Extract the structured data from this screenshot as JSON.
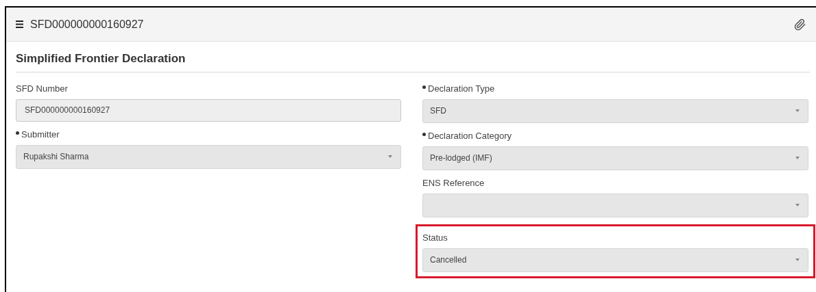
{
  "header": {
    "title": "SFD000000000160927"
  },
  "section": {
    "title": "Simplified Frontier Declaration"
  },
  "columns": [
    {
      "fields": [
        {
          "label": "SFD Number",
          "required": false,
          "kind": "text",
          "value": "SFD000000000160927",
          "highlighted": false
        },
        {
          "label": "Submitter",
          "required": true,
          "kind": "select",
          "value": "Rupakshi Sharma",
          "highlighted": false
        }
      ]
    },
    {
      "fields": [
        {
          "label": "Declaration Type",
          "required": true,
          "kind": "select",
          "value": "SFD",
          "highlighted": false
        },
        {
          "label": "Declaration Category",
          "required": true,
          "kind": "select",
          "value": "Pre-lodged (IMF)",
          "highlighted": false
        },
        {
          "label": "ENS Reference",
          "required": false,
          "kind": "select",
          "highlighted": false
        },
        {
          "label": "Status",
          "required": false,
          "kind": "select",
          "value": "Cancelled",
          "highlighted": true
        }
      ]
    }
  ]
}
